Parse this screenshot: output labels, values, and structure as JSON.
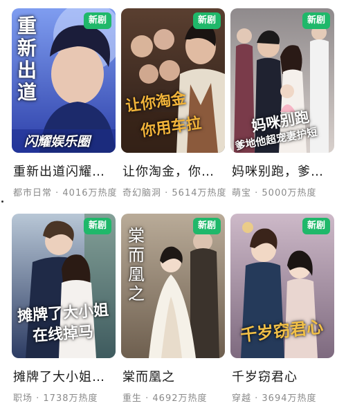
{
  "dramas": [
    {
      "badge": "新剧",
      "title": "重新出道闪耀娱乐圈",
      "meta": "都市日常 · 4016万热度",
      "poster_text_main": "重新出道",
      "poster_text_sub": "闪耀娱乐圈",
      "colors": {
        "bg1": "#3c55c9",
        "bg2": "#9ab2f2"
      }
    },
    {
      "badge": "新剧",
      "title": "让你淘金，你用车拉",
      "meta": "奇幻脑洞 · 5614万热度",
      "poster_text_main": "让你淘金",
      "poster_text_sub": "你用车拉",
      "colors": {
        "bg1": "#4a3428",
        "bg2": "#c79a6d"
      }
    },
    {
      "badge": "新剧",
      "title": "妈咪别跑，爹地他超宠妻护短",
      "meta": "萌宝 · 5000万热度",
      "poster_text_main": "妈咪别跑",
      "poster_text_sub": "爹地他超宠妻护短",
      "colors": {
        "bg1": "#a4a0a5",
        "bg2": "#f2ece8"
      }
    },
    {
      "badge": "新剧",
      "title": "摊牌了大小姐在线掉马",
      "meta": "职场 · 1738万热度",
      "poster_text_main": "摊牌了大小姐",
      "poster_text_sub": "在线掉马",
      "colors": {
        "bg1": "#3e4a6b",
        "bg2": "#d8c8b8"
      }
    },
    {
      "badge": "新剧",
      "title": "棠而凰之",
      "meta": "重生 · 4692万热度",
      "poster_text_main": "棠而凰之",
      "poster_text_sub": "",
      "colors": {
        "bg1": "#6e5f4f",
        "bg2": "#ece4d6"
      }
    },
    {
      "badge": "新剧",
      "title": "千岁窃君心",
      "meta": "穿越 · 3694万热度",
      "poster_text_main": "千岁窃君心",
      "poster_text_sub": "",
      "colors": {
        "bg1": "#7b6a8a",
        "bg2": "#e9d9c6"
      }
    }
  ]
}
